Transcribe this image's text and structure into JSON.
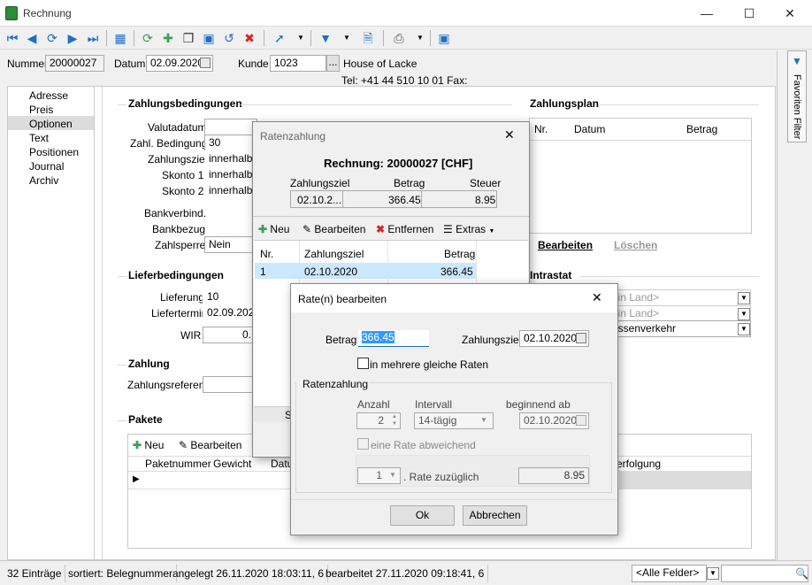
{
  "window": {
    "title": "Rechnung"
  },
  "header": {
    "nummer_label": "Nummer",
    "nummer": "20000027",
    "datum_label": "Datum",
    "datum": "02.09.2020",
    "kunde_label": "Kunde",
    "kunde": "1023",
    "kunde_name": "House of Lacke",
    "kunde_contact": "Tel: +41 44 510 10 01   Fax:"
  },
  "nav": [
    "Adresse",
    "Preis",
    "Optionen",
    "Text",
    "Positionen",
    "Journal",
    "Archiv"
  ],
  "zahlungsbedingungen": {
    "title": "Zahlungsbedingungen",
    "valutadatum_label": "Valutadatum",
    "zahl_bedingung_label": "Zahl. Bedingung",
    "zahl_bedingung": "30",
    "zahlungsziel_label": "Zahlungsziel",
    "zahlungsziel": "innerhalb v",
    "skonto1_label": "Skonto 1",
    "skonto1": "innerhalb w",
    "skonto2_label": "Skonto 2",
    "skonto2": "innerhalb w",
    "bankverbind_label": "Bankverbind.",
    "bankbezug_label": "Bankbezug",
    "zahlsperre_label": "Zahlsperre",
    "zahlsperre": "Nein"
  },
  "lieferbedingungen": {
    "title": "Lieferbedingungen",
    "lieferung_label": "Lieferung",
    "lieferung": "10",
    "liefertermin_label": "Liefertermin",
    "liefertermin": "02.09.2020",
    "wir_label": "WIR",
    "wir": "0."
  },
  "zahlung": {
    "title": "Zahlung",
    "referenz_label": "Zahlungsreferenz"
  },
  "pakete": {
    "title": "Pakete",
    "new_label": "Neu",
    "edit_label": "Bearbeiten",
    "columns": [
      "Paketnummer",
      "Gewicht",
      "Datu",
      "erfolgung"
    ]
  },
  "zahlungsplan": {
    "title": "Zahlungsplan",
    "columns": [
      "Nr.",
      "Datum",
      "Betrag"
    ],
    "edit_label": "Bearbeiten",
    "delete_label": "Löschen"
  },
  "intrastat": {
    "title": "Intrastat",
    "rows": [
      "ein Land>",
      "ein Land>",
      "assenverkehr"
    ]
  },
  "ratenzahlung": {
    "title": "Ratenzahlung",
    "rechnung": "Rechnung: 20000027 [CHF]",
    "summary_headers": [
      "Zahlungsziel",
      "Betrag",
      "Steuer"
    ],
    "summary_values": [
      "02.10.2...",
      "366.45",
      "8.95"
    ],
    "toolbar": {
      "new": "Neu",
      "edit": "Bearbeiten",
      "remove": "Entfernen",
      "extras": "Extras"
    },
    "columns": [
      "Nr.",
      "Zahlungsziel",
      "Betrag"
    ],
    "rows": [
      [
        "1",
        "02.10.2020",
        "366.45"
      ]
    ],
    "bottom_fragment": "S"
  },
  "rate_dialog": {
    "title": "Rate(n) bearbeiten",
    "betrag_label": "Betrag",
    "betrag": "366.45",
    "zahlungsziel_label": "Zahlungsziel",
    "zahlungsziel": "02.10.2020",
    "mehrere_label": "in mehrere gleiche Raten",
    "group_label": "Ratenzahlung",
    "anzahl_label": "Anzahl",
    "anzahl": "2",
    "intervall_label": "Intervall",
    "intervall": "14-tägig",
    "beginnend_label": "beginnend ab",
    "beginnend": "02.10.2020",
    "abweichend_label": "eine Rate abweichend",
    "rate_nr": "1",
    "rate_zuzueglich_label": ". Rate zuzüglich",
    "rate_betrag": "8.95",
    "ok_label": "Ok",
    "cancel_label": "Abbrechen"
  },
  "sidebar": {
    "favoriten_label": "Favoriten Filter"
  },
  "statusbar": {
    "entries": "32 Einträge",
    "sort": "sortiert: Belegnummer",
    "created": "angelegt 26.11.2020 18:03:11,  6",
    "edited": "bearbeitet 27.11.2020 09:18:41,  6",
    "filter": "<Alle Felder>"
  },
  "colors": {
    "accent": "#1e6fc9",
    "selection": "#cce8ff",
    "highlight": "#3399ff"
  }
}
